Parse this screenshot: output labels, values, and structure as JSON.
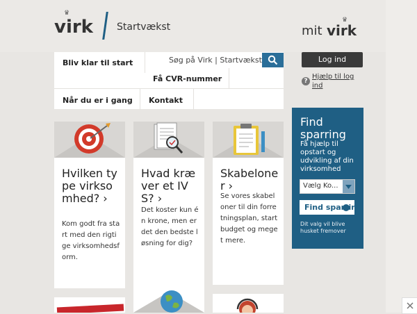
{
  "header": {
    "logo": "virk",
    "section": "Startvækst",
    "mit_logo_prefix": "mit",
    "mit_logo_brand": "virk"
  },
  "nav": {
    "items": [
      {
        "label": "Bliv klar til start"
      },
      {
        "label": "Få CVR-nummer"
      },
      {
        "label": "Når du er i gang"
      },
      {
        "label": "Kontakt"
      }
    ],
    "search_placeholder": "Søg på Virk | Startvækst"
  },
  "account": {
    "login_label": "Log ind",
    "help_label": "Hjælp til log ind"
  },
  "cards": [
    {
      "title": "Hvilken type virksomhed? ›",
      "text": "Kom godt fra start med den rigtige virksomhedsform."
    },
    {
      "title": "Hvad kræver et IVS? ›",
      "text": "Det koster kun én krone, men er det den bedste løsning for dig?"
    },
    {
      "title": "Skabeloner ›",
      "text": "Se vores skabeloner til din forretningsplan, startbudget og meget mere."
    }
  ],
  "find": {
    "title": "Find sparring",
    "subtitle": "Få hjælp til opstart og udvikling af din virksomhed",
    "select_value": "Vælg Ko...",
    "button_label": "Find sparring",
    "note": "Dit valg vil blive husket fremover"
  },
  "colors": {
    "brand_blue": "#1f5f84",
    "background": "#e8e6e3",
    "target_red": "#d23a2a"
  }
}
